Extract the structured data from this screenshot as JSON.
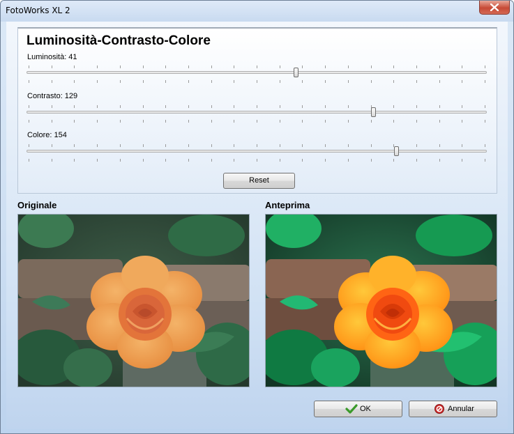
{
  "window": {
    "title": "FotoWorks XL 2"
  },
  "panel": {
    "title": "Luminosità-Contrasto-Colore",
    "sliders": [
      {
        "label": "Luminosità: 41",
        "value": 41,
        "fraction": 0.586
      },
      {
        "label": "Contrasto: 129",
        "value": 129,
        "fraction": 0.755
      },
      {
        "label": "Colore: 154",
        "value": 154,
        "fraction": 0.806
      }
    ],
    "reset_label": "Reset"
  },
  "images": {
    "original_label": "Originale",
    "preview_label": "Anteprima"
  },
  "buttons": {
    "ok_label": "OK",
    "cancel_label": "Annular"
  },
  "colors": {
    "accent_check": "#3a9a2a",
    "cancel_icon": "#cc2a2a"
  },
  "icons": {
    "ok": "checkmark-icon",
    "cancel": "cancel-icon",
    "close": "close-icon"
  }
}
